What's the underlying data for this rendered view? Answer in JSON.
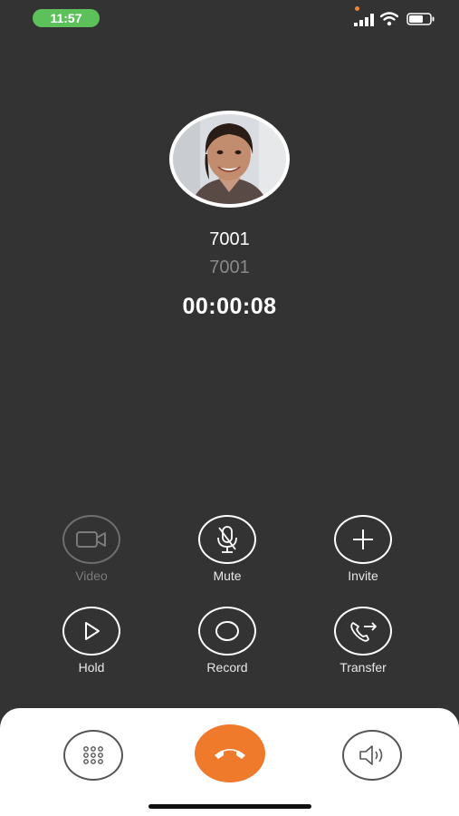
{
  "status_bar": {
    "time": "11:57",
    "icons": [
      "signal-icon",
      "wifi-icon",
      "battery-icon"
    ]
  },
  "caller": {
    "name": "7001",
    "number": "7001",
    "duration": "00:00:08"
  },
  "controls": [
    {
      "label": "Video",
      "icon": "video-camera-icon",
      "enabled": false
    },
    {
      "label": "Mute",
      "icon": "microphone-off-icon",
      "enabled": true
    },
    {
      "label": "Invite",
      "icon": "plus-icon",
      "enabled": true
    },
    {
      "label": "Hold",
      "icon": "play-icon",
      "enabled": true
    },
    {
      "label": "Record",
      "icon": "record-icon",
      "enabled": true
    },
    {
      "label": "Transfer",
      "icon": "phone-transfer-icon",
      "enabled": true
    }
  ],
  "bottom_bar": {
    "keypad_icon": "keypad-icon",
    "hangup_icon": "hangup-icon",
    "speaker_icon": "speaker-icon"
  },
  "colors": {
    "background": "#333333",
    "hangup": "#f07a2c",
    "time_pill": "#5cc15b"
  }
}
